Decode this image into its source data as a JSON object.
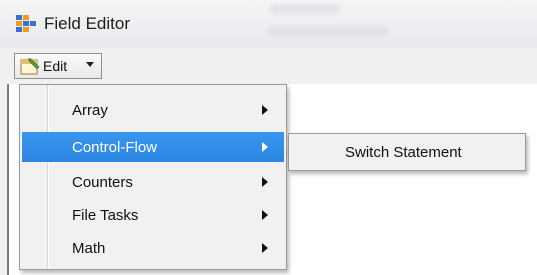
{
  "window": {
    "title": "Field Editor"
  },
  "toolbar": {
    "edit_label": "Edit"
  },
  "menu": {
    "items": [
      {
        "label": "Array",
        "has_submenu": true,
        "highlighted": false
      },
      {
        "label": "Control-Flow",
        "has_submenu": true,
        "highlighted": true
      },
      {
        "label": "Counters",
        "has_submenu": true,
        "highlighted": false
      },
      {
        "label": "File Tasks",
        "has_submenu": true,
        "highlighted": false
      },
      {
        "label": "Math",
        "has_submenu": true,
        "highlighted": false
      }
    ]
  },
  "submenu": {
    "items": [
      {
        "label": "Switch Statement"
      }
    ]
  },
  "colors": {
    "highlight": "#3a96ef",
    "menu_background": "#f1f1f1",
    "window_background": "#f0f0f0"
  },
  "icons": {
    "app": "field-editor-app-icon",
    "edit": "edit-icon",
    "dropdown": "chevron-down-icon",
    "submenu": "chevron-right-icon"
  }
}
